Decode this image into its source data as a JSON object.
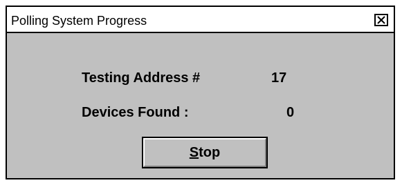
{
  "window": {
    "title": "Polling System Progress",
    "close_icon": "close-icon"
  },
  "status": {
    "testing_label": "Testing Address #",
    "testing_value": "17",
    "devices_label": "Devices Found :",
    "devices_value": "0"
  },
  "actions": {
    "stop_mnemonic": "S",
    "stop_rest": "top"
  },
  "colors": {
    "dialog_face": "#c0c0c0",
    "titlebar": "#ffffff",
    "border": "#000000"
  }
}
